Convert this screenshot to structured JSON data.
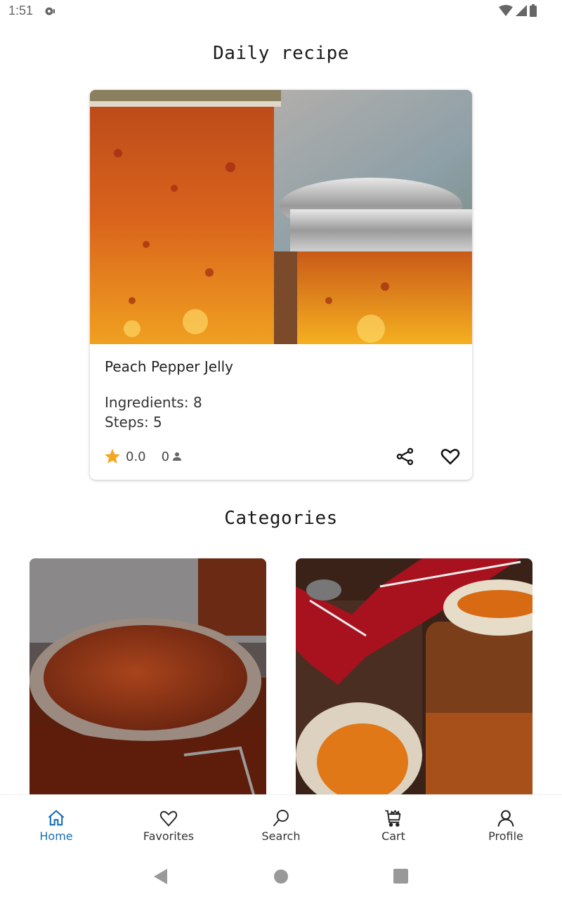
{
  "status_bar": {
    "time": "1:51",
    "icons": [
      "notification-icon",
      "wifi-icon",
      "signal-icon",
      "battery-icon"
    ]
  },
  "daily": {
    "title": "Daily recipe",
    "recipe": {
      "name": "Peach Pepper Jelly",
      "ingredients_label": "Ingredients: 8",
      "steps_label": "Steps: 5",
      "rating": "0.0",
      "rating_count": "0",
      "image_alt": "Jars of peach pepper jelly"
    },
    "actions": {
      "share": "share-icon",
      "favorite": "heart-icon"
    }
  },
  "categories": {
    "title": "Categories",
    "items": [
      {
        "image_alt": "Jar of apple butter"
      },
      {
        "image_alt": "Jar of orange marmalade with bread"
      }
    ]
  },
  "bottom_nav": {
    "items": [
      {
        "label": "Home",
        "icon": "home-icon",
        "active": true
      },
      {
        "label": "Favorites",
        "icon": "heart-icon",
        "active": false
      },
      {
        "label": "Search",
        "icon": "search-icon",
        "active": false
      },
      {
        "label": "Cart",
        "icon": "cart-icon",
        "active": false
      },
      {
        "label": "Profile",
        "icon": "profile-icon",
        "active": false
      }
    ]
  },
  "colors": {
    "accent": "#1a6fb5",
    "star": "#f5a623",
    "text": "#222222",
    "system_gray": "#999999"
  }
}
